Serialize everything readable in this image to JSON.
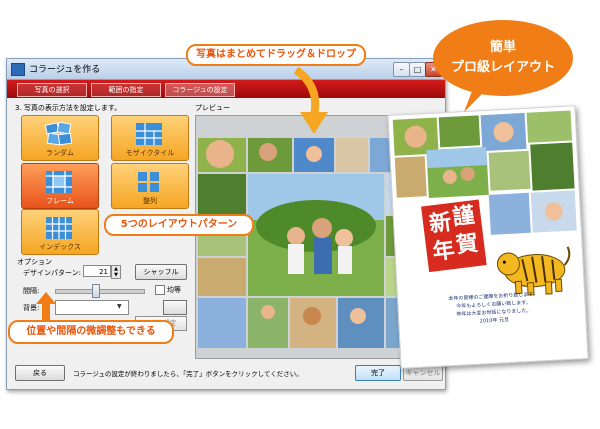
{
  "window": {
    "title": "コラージュを作る",
    "min": "–",
    "max": "□",
    "close": "✕",
    "steps": [
      "写真の選択",
      "範囲の指定",
      "コラージュの設定"
    ]
  },
  "settings": {
    "instruction": "3. 写真の表示方法を設定します。",
    "layouts": [
      {
        "label": "ランダム",
        "icon": "random-layout-icon"
      },
      {
        "label": "モザイクタイル",
        "icon": "mosaic-layout-icon"
      },
      {
        "label": "フレーム",
        "icon": "frame-layout-icon"
      },
      {
        "label": "整列",
        "icon": "grid-layout-icon"
      },
      {
        "label": "インデックス",
        "icon": "index-layout-icon"
      }
    ],
    "selected_layout": "フレーム",
    "options_label": "オプション",
    "pattern_label": "デザインパターン:",
    "pattern_value": "21",
    "shuffle_label": "シャッフル",
    "spacing_label": "間隔:",
    "spacing_level": 0.45,
    "equal_label": "均等",
    "bg_label": "背景:",
    "photo_settings_label": "写真の設定"
  },
  "preview": {
    "label": "プレビュー"
  },
  "footer": {
    "back_label": "戻る",
    "status": "コラージュの設定が終わりましたら、「完了」ボタンをクリックしてください。",
    "finish_label": "完了",
    "cancel_label": "キャンセル"
  },
  "callouts": {
    "dragdrop": "写真はまとめてドラッグ＆ドロップ",
    "layouts": "5つのレイアウトパターン",
    "adjust": "位置や間隔の微調整もできる",
    "badge_line1": "簡単",
    "badge_line2": "プロ級レイアウト"
  },
  "card": {
    "title_chars": [
      "新",
      "謹",
      "年",
      "賀"
    ],
    "greeting": [
      "本年の皆様のご健康をお祈り致します。",
      "今年もよろしくお願い致します。",
      "昨年は大変お世話になりました。",
      "2010年 元旦"
    ]
  },
  "colors": {
    "accent": "#f07d16",
    "step_bar": "#b50f0f",
    "layout_button": "#f5a623",
    "layout_selected": "#e8531a",
    "card_title": "#d62b1e"
  }
}
